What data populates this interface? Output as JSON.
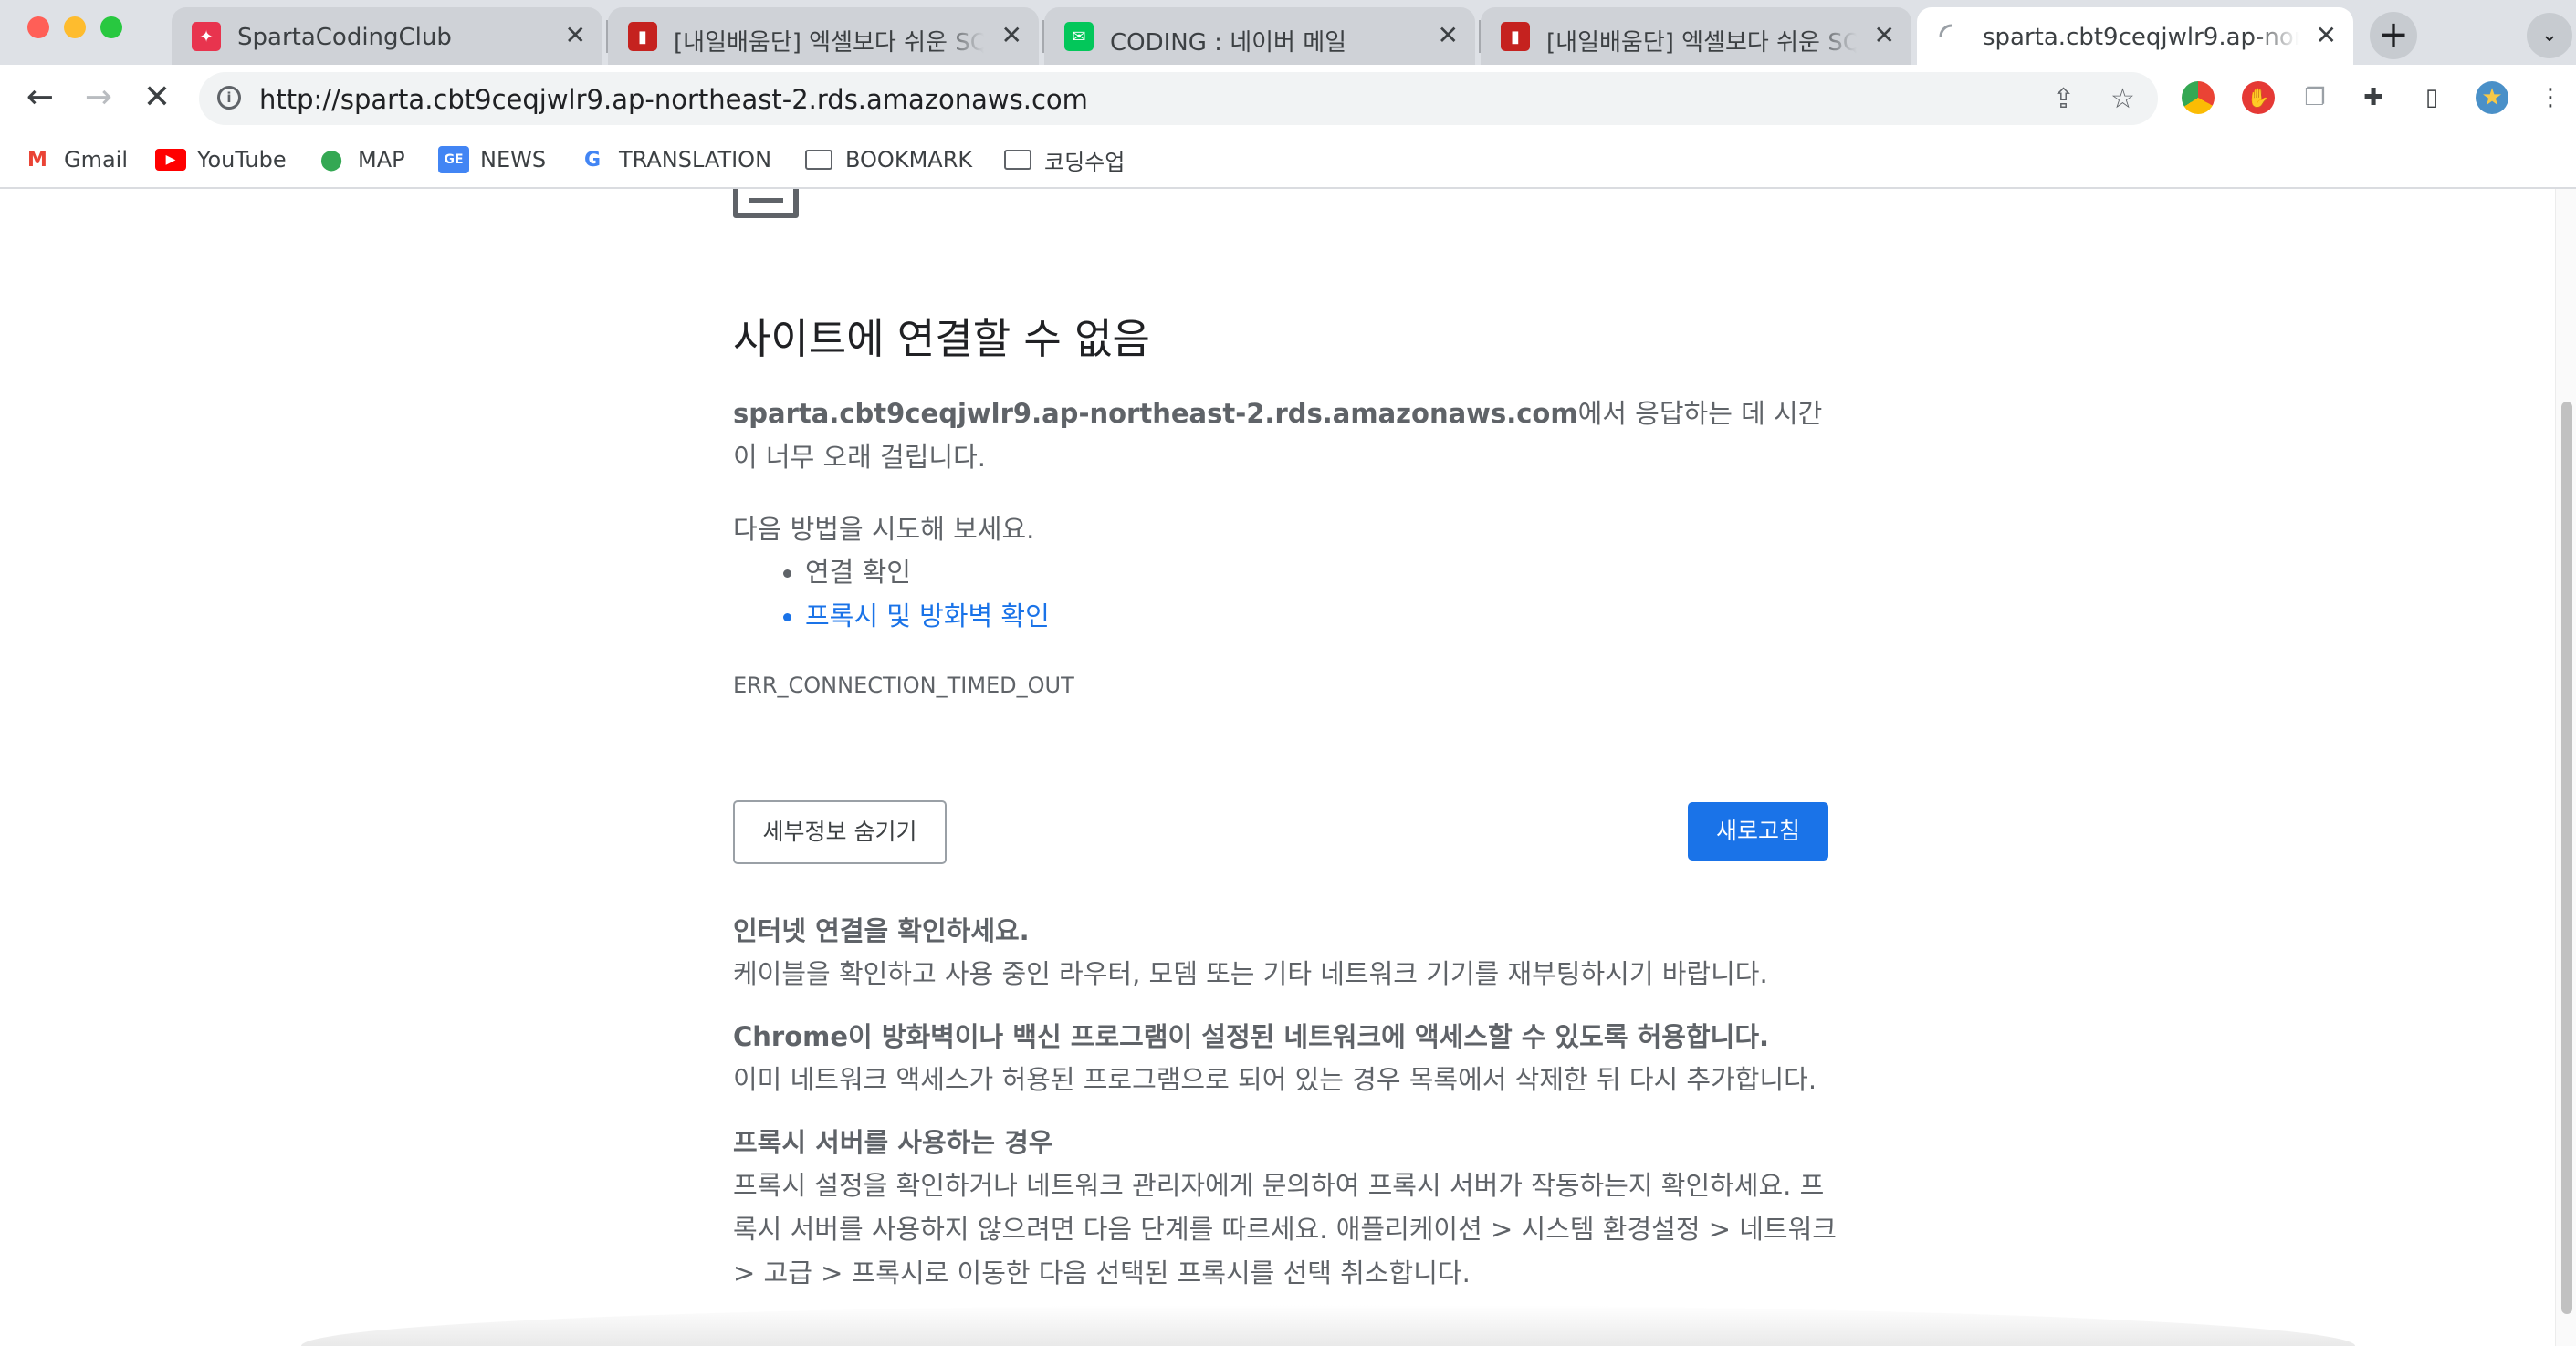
{
  "tabs": [
    {
      "title": "SpartaCodingClub",
      "favicon": "sparta-logo-icon",
      "favicon_color": "#e8344e",
      "active": false
    },
    {
      "title": "[내일배움단] 엑셀보다 쉬운 SQL - 1",
      "favicon": "book-icon",
      "favicon_color": "#c5221f",
      "active": false
    },
    {
      "title": "CODING : 네이버 메일",
      "favicon": "naver-mail-icon",
      "favicon_color": "#03c75a",
      "active": false
    },
    {
      "title": "[내일배움단] 엑셀보다 쉬운 SQL - 1",
      "favicon": "book-icon",
      "favicon_color": "#c5221f",
      "active": false
    },
    {
      "title": "sparta.cbt9ceqjwlr9.ap-northeast-2.rds.amazonaws.com",
      "favicon": "loading-spinner-icon",
      "favicon_color": "#9aa0a6",
      "active": true
    }
  ],
  "toolbar": {
    "url": "http://sparta.cbt9ceqjwlr9.ap-northeast-2.rds.amazonaws.com"
  },
  "bookmarks": [
    {
      "label": "Gmail",
      "icon": "gmail-icon"
    },
    {
      "label": "YouTube",
      "icon": "youtube-icon"
    },
    {
      "label": "MAP",
      "icon": "maps-icon"
    },
    {
      "label": "NEWS",
      "icon": "google-news-icon"
    },
    {
      "label": "TRANSLATION",
      "icon": "translate-icon"
    },
    {
      "label": "BOOKMARK",
      "icon": "folder-icon"
    },
    {
      "label": "코딩수업",
      "icon": "folder-icon"
    }
  ],
  "error": {
    "title": "사이트에 연결할 수 없음",
    "host": "sparta.cbt9ceqjwlr9.ap-northeast-2.rds.amazonaws.com",
    "message": "에서 응답하는 데 시간이 너무 오래 걸립니다.",
    "try_heading": "다음 방법을 시도해 보세요.",
    "suggestions": [
      "연결 확인",
      "프록시 및 방화벽 확인"
    ],
    "code": "ERR_CONNECTION_TIMED_OUT",
    "details_button": "세부정보 숨기기",
    "reload_button": "새로고침",
    "details": [
      {
        "title": "인터넷 연결을 확인하세요.",
        "body": "케이블을 확인하고 사용 중인 라우터, 모뎀 또는 기타 네트워크 기기를 재부팅하시기 바랍니다."
      },
      {
        "title": "Chrome이 방화벽이나 백신 프로그램이 설정된 네트워크에 액세스할 수 있도록 허용합니다.",
        "body": "이미 네트워크 액세스가 허용된 프로그램으로 되어 있는 경우 목록에서 삭제한 뒤 다시 추가합니다."
      },
      {
        "title": "프록시 서버를 사용하는 경우",
        "body": "프록시 설정을 확인하거나 네트워크 관리자에게 문의하여 프록시 서버가 작동하는지 확인하세요. 프록시 서버를 사용하지 않으려면 다음 단계를 따르세요. 애플리케이션 > 시스템 환경설정 > 네트워크 > 고급 > 프록시로 이동한 다음 선택된 프록시를 선택 취소합니다."
      }
    ]
  },
  "colors": {
    "link": "#1a73e8",
    "reload_button": "#1a73e8",
    "traffic_close": "#ff5f57",
    "traffic_min": "#febc2e",
    "traffic_max": "#28c840"
  }
}
